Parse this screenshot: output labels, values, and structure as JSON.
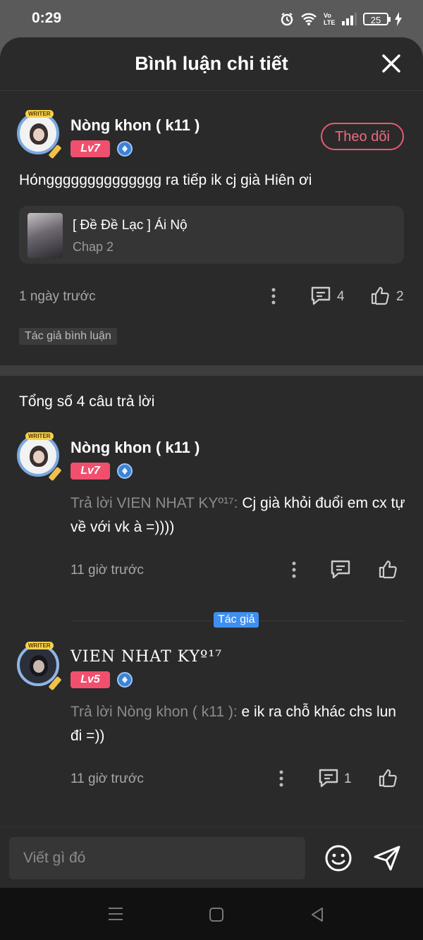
{
  "status_bar": {
    "time": "0:29",
    "battery": "25",
    "network": "Vo LTE"
  },
  "header": {
    "title": "Bình luận chi tiết"
  },
  "main_comment": {
    "username": "Nòng khon ( k11 )",
    "level": "Lv7",
    "follow_label": "Theo dõi",
    "text": "Hóngggggggggggggg ra tiếp ik cj già Hiên ơi",
    "reference": {
      "title": "[ Đề Đề Lạc ] Ái Nộ",
      "subtitle": "Chap 2"
    },
    "time": "1 ngày trước",
    "comment_count": "4",
    "like_count": "2",
    "author_chip": "Tác giả bình luận"
  },
  "replies_header": "Tổng số 4 câu trả lời",
  "replies": [
    {
      "username": "Nòng khon ( k11 )",
      "level": "Lv7",
      "prefix": "Trả lời VIEN NHAT KYº¹⁷:",
      "text": " Cj già khỏi đuổi em cx tự về với vk à =))))",
      "time": "11 giờ trước"
    },
    {
      "username": "VIEN NHAT KYº¹⁷",
      "badge": "Tác giả",
      "level": "Lv5",
      "prefix": "Trả lời Nòng khon ( k11 ):",
      "text": " e ik ra chỗ khác chs lun đi =))",
      "time": "11 giờ trước",
      "comment_count": "1"
    }
  ],
  "input": {
    "placeholder": "Viết gì đó"
  },
  "avatar_tag": "WRITER",
  "colors": {
    "sheet_bg": "#2a2a2a",
    "accent_pink": "#f0506e",
    "author_blue": "#3f8ff0"
  }
}
